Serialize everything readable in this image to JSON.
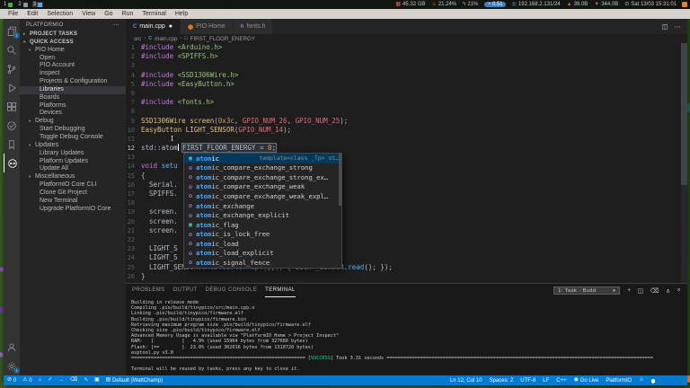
{
  "topbar": {
    "workspaces": [
      {
        "num": "1",
        "icon": "plant"
      },
      {
        "num": "2",
        "icon": "monitor"
      },
      {
        "num": "3",
        "icon": "file",
        "active": true
      }
    ],
    "stats": [
      {
        "name": "memory-stat",
        "glyph": "▦",
        "color": "#e06060",
        "text": "45.32 GB"
      },
      {
        "name": "temperature-stat",
        "glyph": "♨",
        "color": "#e09050",
        "text": "21.24%"
      },
      {
        "name": "cpu-stat",
        "glyph": "ϟ",
        "color": "#e0c050",
        "text": "21%"
      },
      {
        "name": "load-average-stat",
        "glyph": "◔",
        "color": "#ffffff",
        "text": "0.51",
        "pill": true
      },
      {
        "name": "ip-address-stat",
        "glyph": "◎",
        "color": "#58a6e8",
        "text": "192.168.2.131/24"
      },
      {
        "name": "net-up-stat",
        "glyph": "▲",
        "color": "#d06050",
        "text": "39.0B"
      },
      {
        "name": "net-down-stat",
        "glyph": "▼",
        "color": "#d06050",
        "text": "344.0B"
      },
      {
        "name": "clock-stat",
        "glyph": "⊙",
        "color": "#cccccc",
        "text": "Sat 13/03 15:31:01"
      }
    ]
  },
  "menubar": [
    "File",
    "Edit",
    "Selection",
    "View",
    "Go",
    "Run",
    "Terminal",
    "Help"
  ],
  "activitybar": {
    "top": [
      {
        "name": "explorer-icon",
        "badge": "1"
      },
      {
        "name": "search-icon"
      },
      {
        "name": "source-control-icon"
      },
      {
        "name": "run-debug-icon"
      },
      {
        "name": "extensions-icon"
      },
      {
        "name": "test-icon"
      },
      {
        "name": "bookmarks-icon"
      },
      {
        "name": "platformio-icon",
        "active": true
      }
    ],
    "bottom": [
      {
        "name": "account-icon"
      },
      {
        "name": "settings-gear-icon",
        "badge": "1"
      }
    ]
  },
  "sidebar": {
    "title": "PLATFORMIO",
    "rows": [
      {
        "l": "PROJECT TASKS",
        "t": "header",
        "c": "▸"
      },
      {
        "l": "QUICK ACCESS",
        "t": "header",
        "c": "▾"
      },
      {
        "l": "PIO Home",
        "t": "group",
        "c": "▾"
      },
      {
        "l": "Open",
        "t": "item"
      },
      {
        "l": "PIO Account",
        "t": "item"
      },
      {
        "l": "Inspect",
        "t": "item"
      },
      {
        "l": "Projects & Configuration",
        "t": "item"
      },
      {
        "l": "Libraries",
        "t": "item",
        "sel": true
      },
      {
        "l": "Boards",
        "t": "item"
      },
      {
        "l": "Platforms",
        "t": "item"
      },
      {
        "l": "Devices",
        "t": "item"
      },
      {
        "l": "Debug",
        "t": "group",
        "c": "▾"
      },
      {
        "l": "Start Debugging",
        "t": "item"
      },
      {
        "l": "Toggle Debug Console",
        "t": "item"
      },
      {
        "l": "Updates",
        "t": "group",
        "c": "▾"
      },
      {
        "l": "Library Updates",
        "t": "item"
      },
      {
        "l": "Platform Updates",
        "t": "item"
      },
      {
        "l": "Update All",
        "t": "item"
      },
      {
        "l": "Miscellaneous",
        "t": "group",
        "c": "▾"
      },
      {
        "l": "PlatformIO Core CLI",
        "t": "item"
      },
      {
        "l": "Clone Git Project",
        "t": "item"
      },
      {
        "l": "New Terminal",
        "t": "item"
      },
      {
        "l": "Upgrade PlatformIO Core",
        "t": "item"
      }
    ]
  },
  "tabs": [
    {
      "label": "main.cpp",
      "icon": "cpp",
      "iconGlyph": "C",
      "active": true,
      "modified": true
    },
    {
      "label": "PIO Home",
      "icon": "pio",
      "iconGlyph": "◉"
    },
    {
      "label": "fonts.h",
      "icon": "header",
      "iconGlyph": "h"
    }
  ],
  "editor_actions": [
    {
      "name": "split-editor-icon",
      "glyph": "◫"
    },
    {
      "name": "more-actions-icon",
      "glyph": "⋯"
    }
  ],
  "breadcrumb": [
    {
      "label": "src"
    },
    {
      "label": "main.cpp",
      "icon": "cpp",
      "iconGlyph": "C"
    },
    {
      "label": "FIRST_FLOOR_ENERGY",
      "icon": "symbol",
      "iconGlyph": "□"
    }
  ],
  "editor": {
    "lines": [
      {
        "t": [
          [
            "#include ",
            "kw"
          ],
          [
            "<Arduino.h>",
            "str"
          ]
        ]
      },
      {
        "t": [
          [
            "#include ",
            "kw"
          ],
          [
            "<SPIFFS.h>",
            "str"
          ]
        ]
      },
      {
        "t": []
      },
      {
        "t": [
          [
            "#include ",
            "kw"
          ],
          [
            "<SSD1306Wire.h>",
            "str"
          ]
        ]
      },
      {
        "t": [
          [
            "#include ",
            "kw"
          ],
          [
            "<EasyButton.h>",
            "str"
          ]
        ]
      },
      {
        "t": []
      },
      {
        "t": [
          [
            "#include ",
            "kw"
          ],
          [
            "<fonts.h>",
            "str"
          ]
        ]
      },
      {
        "t": []
      },
      {
        "t": [
          [
            "SSD1306Wire",
            "type"
          ],
          [
            " ",
            "txt"
          ],
          [
            "screen",
            "type"
          ],
          [
            "(",
            "txt"
          ],
          [
            "0x3c",
            "num"
          ],
          [
            ", ",
            "txt"
          ],
          [
            "GPIO_NUM_26",
            "var"
          ],
          [
            ", ",
            "txt"
          ],
          [
            "GPIO_NUM_25",
            "var"
          ],
          [
            ");",
            "txt"
          ]
        ]
      },
      {
        "t": [
          [
            "EasyButton",
            "type"
          ],
          [
            " ",
            "txt"
          ],
          [
            "LIGHT_SENSOR",
            "type"
          ],
          [
            "(",
            "txt"
          ],
          [
            "GPIO_NUM_14",
            "var"
          ],
          [
            ");",
            "txt"
          ]
        ]
      },
      {
        "t": []
      },
      {
        "cur": true,
        "t": [
          [
            "std::atom",
            "txt"
          ],
          {
            "cursor": true
          },
          [
            " ",
            "txt"
          ],
          {
            "box": [
              [
                "FIRST_FLOOR_ENERGY = ",
                "txt"
              ],
              [
                "0",
                "num"
              ],
              [
                ";",
                "txt"
              ]
            ]
          }
        ]
      },
      {
        "t": []
      },
      {
        "t": [
          [
            "void",
            "kw"
          ],
          [
            " ",
            "txt"
          ],
          [
            "setu",
            "fn"
          ]
        ]
      },
      {
        "t": [
          [
            "{",
            "txt"
          ]
        ]
      },
      {
        "t": [
          [
            "  Serial.",
            "txt"
          ]
        ]
      },
      {
        "t": [
          [
            "  SPIFFS.",
            "txt"
          ]
        ]
      },
      {
        "t": []
      },
      {
        "t": [
          [
            "  screen.",
            "txt"
          ]
        ]
      },
      {
        "t": [
          [
            "  screen.",
            "txt"
          ]
        ]
      },
      {
        "t": [
          [
            "  screen.",
            "txt"
          ]
        ]
      },
      {
        "t": []
      },
      {
        "t": [
          [
            "  LIGHT_S",
            "txt"
          ]
        ]
      },
      {
        "t": [
          [
            "  LIGHT_S",
            "txt"
          ]
        ]
      },
      {
        "t": [
          [
            "  LIGHT_SENSOR.",
            "txt"
          ],
          [
            "enableInterrupt",
            "fn"
          ],
          [
            "([]() { LIGHT_SENSOR.",
            "txt"
          ],
          [
            "read",
            "fn"
          ],
          [
            "(); });",
            "txt"
          ]
        ]
      },
      {
        "t": [
          [
            "}",
            "txt"
          ]
        ]
      }
    ]
  },
  "autocomplete": {
    "match": "atom",
    "items": [
      {
        "label": "atomic",
        "kind": "struct",
        "detail": "template<class _Tp> st…",
        "selected": true
      },
      {
        "label": "atomic_compare_exchange_strong",
        "kind": "function"
      },
      {
        "label": "atomic_compare_exchange_strong_ex…",
        "kind": "function"
      },
      {
        "label": "atomic_compare_exchange_weak",
        "kind": "function"
      },
      {
        "label": "atomic_compare_exchange_weak_expl…",
        "kind": "function"
      },
      {
        "label": "atomic_exchange",
        "kind": "function"
      },
      {
        "label": "atomic_exchange_explicit",
        "kind": "function"
      },
      {
        "label": "atomic_flag",
        "kind": "struct"
      },
      {
        "label": "atomic_is_lock_free",
        "kind": "function"
      },
      {
        "label": "atomic_load",
        "kind": "function"
      },
      {
        "label": "atomic_load_explicit",
        "kind": "function"
      },
      {
        "label": "atomic_signal_fence",
        "kind": "function"
      }
    ]
  },
  "panel": {
    "tabs": [
      "PROBLEMS",
      "OUTPUT",
      "DEBUG CONSOLE",
      "TERMINAL"
    ],
    "active_tab": "TERMINAL",
    "task_selector": "1: Task - Build",
    "buttons": [
      {
        "name": "new-terminal-icon",
        "glyph": "+"
      },
      {
        "name": "split-terminal-icon",
        "glyph": "◫"
      },
      {
        "name": "kill-terminal-icon",
        "glyph": "⌫"
      },
      {
        "name": "maximize-panel-icon",
        "glyph": "∧"
      },
      {
        "name": "close-panel-icon",
        "glyph": "×"
      }
    ],
    "terminal_lines": [
      [
        {
          "t": "Building in release mode"
        }
      ],
      [
        {
          "t": "Compiling .pio/build/tinypico/src/main.cpp.o"
        }
      ],
      [
        {
          "t": "Linking .pio/build/tinypico/firmware.elf"
        }
      ],
      [
        {
          "t": "Building .pio/build/tinypico/firmware.bin"
        }
      ],
      [
        {
          "t": "Retrieving maximum program size .pio/build/tinypico/firmware.elf"
        }
      ],
      [
        {
          "t": "Checking size .pio/build/tinypico/firmware.elf"
        }
      ],
      [
        {
          "t": "Advanced Memory Usage is available via \"PlatformIO Home > Project Inspect\""
        }
      ],
      [
        {
          "t": "RAM:   [          ]   4.9% (used 15964 bytes from 327680 bytes)"
        }
      ],
      [
        {
          "t": "Flash: [==        ]  23.0% (used 302016 bytes from 1310720 bytes)"
        }
      ],
      [
        {
          "t": "esptool.py v3.0"
        }
      ],
      [
        {
          "t": "============================================================== ["
        },
        {
          "t": "SUCCESS",
          "c": "ok"
        },
        {
          "t": "] Took 3.31 seconds "
        },
        {
          "t": "==============================================================================================="
        }
      ],
      [
        {
          "t": ""
        }
      ],
      [
        {
          "t": "Terminal will be reused by tasks, press any key to close it."
        }
      ]
    ]
  },
  "statusbar": {
    "left": [
      {
        "name": "problems-errors",
        "glyph": "⊘",
        "text": "0"
      },
      {
        "name": "problems-warnings",
        "glyph": "⚠",
        "text": "0"
      },
      {
        "name": "pio-home-button",
        "glyph": "⌂"
      },
      {
        "name": "pio-build-button",
        "glyph": "✓"
      },
      {
        "name": "pio-upload-button",
        "glyph": "→"
      },
      {
        "name": "pio-clean-button",
        "glyph": "⌫"
      },
      {
        "name": "pio-serial-monitor-button",
        "glyph": "∿"
      },
      {
        "name": "pio-terminal-button",
        "glyph": "▣"
      },
      {
        "name": "pio-env-selector",
        "glyph": "▤",
        "text": "Default (WattChamp)"
      }
    ],
    "right": [
      {
        "name": "cursor-position",
        "text": "Ln 12, Col 10"
      },
      {
        "name": "indentation",
        "text": "Spaces: 2"
      },
      {
        "name": "encoding",
        "text": "UTF-8"
      },
      {
        "name": "eol",
        "text": "LF"
      },
      {
        "name": "language-mode",
        "text": "C++"
      },
      {
        "name": "go-live",
        "glyph": "◉",
        "text": "Go Live"
      },
      {
        "name": "platformio-status",
        "text": "PlatformIO"
      },
      {
        "name": "feedback",
        "glyph": "☺"
      },
      {
        "name": "notifications",
        "bell": true
      }
    ]
  }
}
